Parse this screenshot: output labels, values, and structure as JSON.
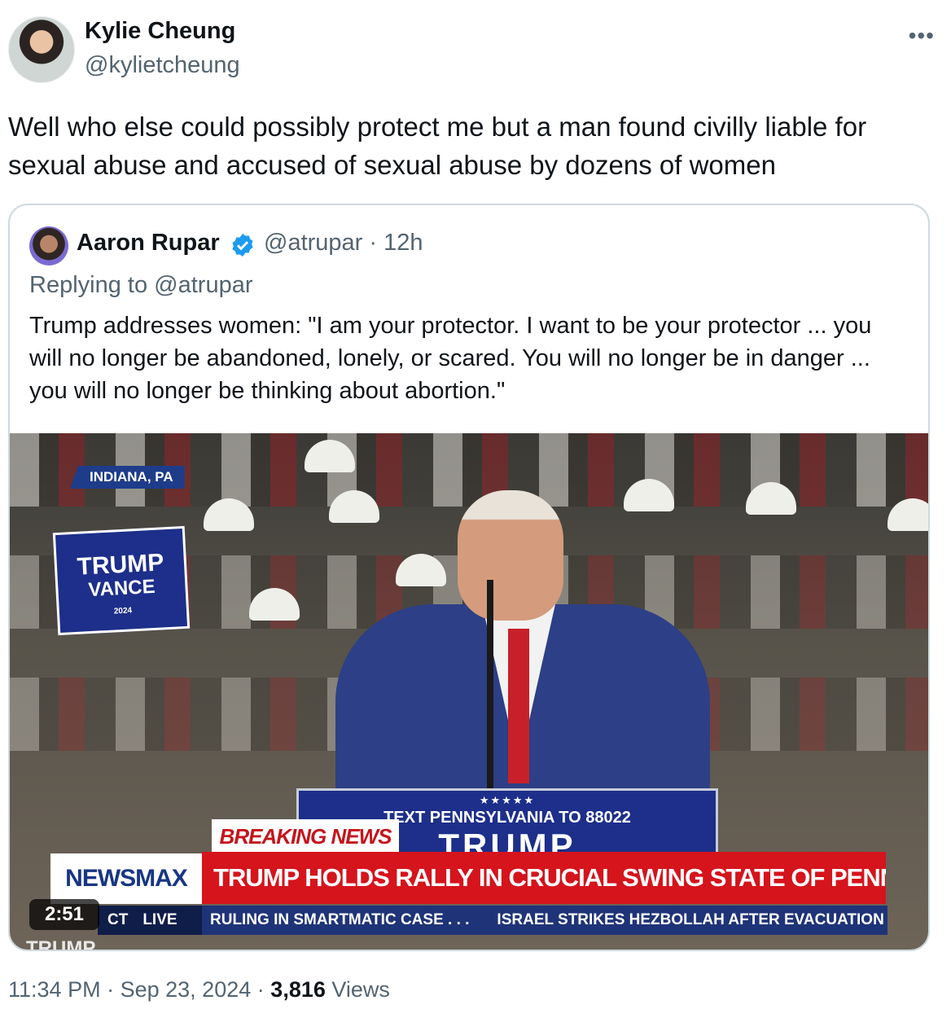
{
  "author": {
    "name": "Kylie Cheung",
    "handle": "@kylietcheung",
    "more_icon": "more-horizontal-icon"
  },
  "tweet": {
    "text": "Well who else could possibly protect me but a man found civilly liable for sexual abuse and accused of sexual abuse by dozens of women"
  },
  "quote": {
    "name": "Aaron Rupar",
    "verified_icon": "verified-badge-icon",
    "verified_color": "#1d9bf0",
    "meta": "@atrupar · 12h",
    "replying_label": "Replying to",
    "replying_to": "@atrupar",
    "text": "Trump addresses women: \"I am your protector. I want to be your protector ... you will no longer be abandoned, lonely, or scared. You will no longer be in danger ... you will no longer be thinking about abortion.\"",
    "video": {
      "duration": "2:51",
      "location_tag": "INDIANA, PA",
      "sign_line1": "TRUMP",
      "sign_line2": "VANCE",
      "sign_year": "2024",
      "podium_stars": "★★★★★",
      "podium_text": "TEXT PENNSYLVANIA TO 88022",
      "podium_big": "TRUMP",
      "breaking": "BREAKING NEWS",
      "network": "NEWSMAX",
      "headline": "TRUMP HOLDS RALLY IN CRUCIAL SWING STATE OF PENNSYLVANIA",
      "live_ct": "CT",
      "live_label": "LIVE",
      "ticker1": "RULING IN SMARTMATIC CASE . . .",
      "ticker2": "ISRAEL STRIKES HEZBOLLAH AFTER EVACUATION \\",
      "bottom_text": "TRUMP",
      "colors": {
        "headline_red": "#d5141c",
        "network_blue": "#183684",
        "ticker_blue": "#1f3378"
      }
    }
  },
  "footer": {
    "time": "11:34 PM",
    "date": "Sep 23, 2024",
    "views_count": "3,816",
    "views_label": "Views",
    "separator": "·"
  }
}
